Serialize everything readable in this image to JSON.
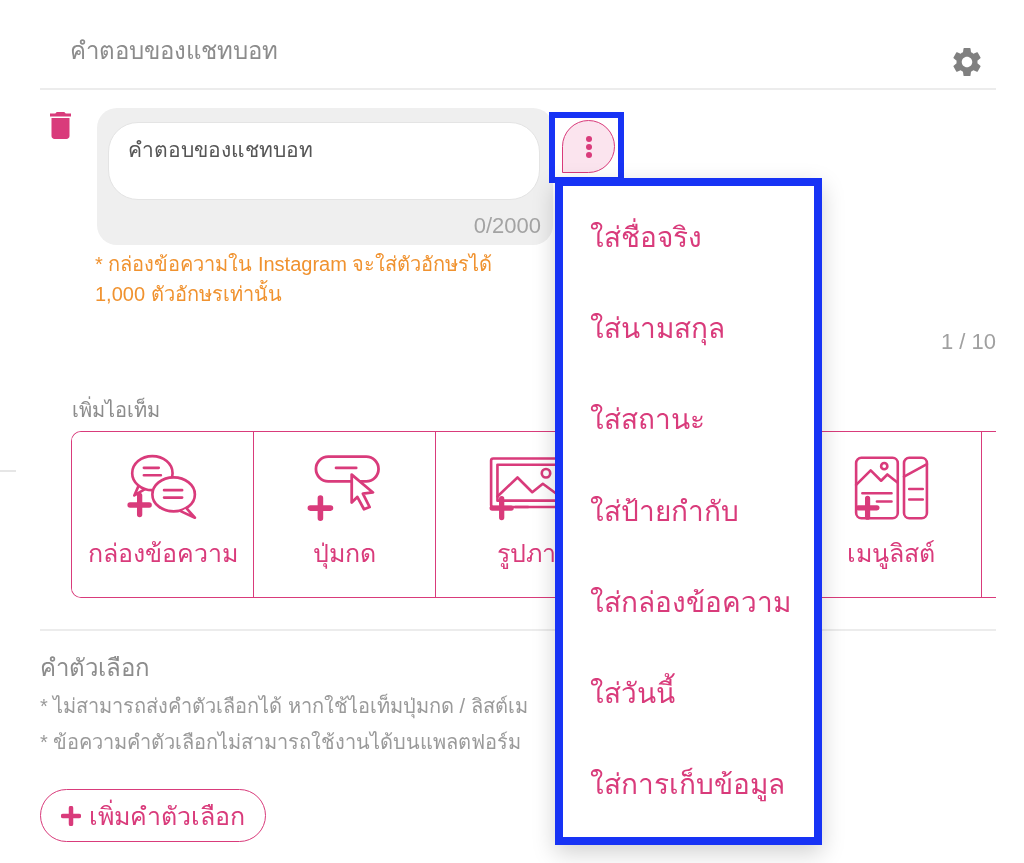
{
  "header": {
    "title": "คำตอบของแชทบอท"
  },
  "reply": {
    "placeholder": "คำตอบของแชทบอท",
    "counter": "0/2000",
    "note": "* กล่องข้อความใน Instagram จะใส่ตัวอักษรได้ 1,000 ตัวอักษรเท่านั้น",
    "page": "1 / 10"
  },
  "menu_button": {
    "highlighted": true
  },
  "menu": {
    "open": true,
    "highlighted": true,
    "items": [
      "ใส่ชื่อจริง",
      "ใส่นามสกุล",
      "ใส่สถานะ",
      "ใส่ป้ายกำกับ",
      "ใส่กล่องข้อความ",
      "ใส่วันนี้",
      "ใส่การเก็บข้อมูล"
    ]
  },
  "add_item": {
    "label": "เพิ่มไอเท็ม",
    "items": [
      {
        "kind": "text_box",
        "label": "กล่องข้อความ"
      },
      {
        "kind": "button",
        "label": "ปุ่มกด"
      },
      {
        "kind": "image",
        "label": "รูปภา"
      },
      {
        "kind": "list_menu",
        "label": "เมนูลิสต์"
      }
    ]
  },
  "quick_replies": {
    "title": "คำตัวเลือก",
    "notes": [
      "* ไม่สามารถส่งคำตัวเลือกได้ หากใช้ไอเท็มปุ่มกด / ลิสต์เม",
      "* ข้อความคำตัวเลือกไม่สามารถใช้งานได้บนแพลตฟอร์ม"
    ],
    "button": "เพิ่มคำตัวเลือก"
  }
}
